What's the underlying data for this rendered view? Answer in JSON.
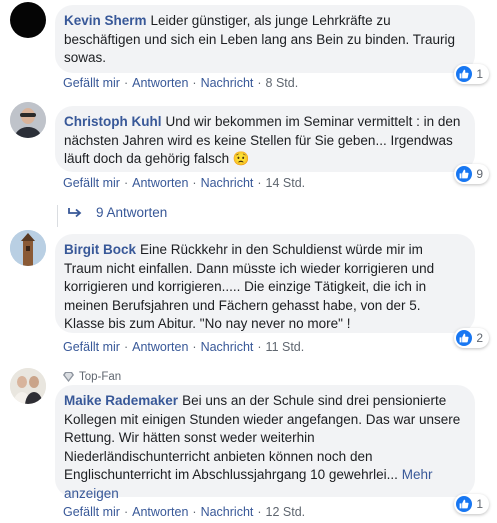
{
  "comments": [
    {
      "author": "Kevin Sherm",
      "text": "Leider günstiger, als junge Lehrkräfte zu beschäftigen und sich ein Leben lang ans Bein zu binden. Traurig sowas.",
      "like": "Gefällt mir",
      "reply": "Antworten",
      "message": "Nachricht",
      "time": "8 Std.",
      "reactions": "1"
    },
    {
      "author": "Christoph Kuhl",
      "text": "Und wir bekommen im Seminar vermittelt : in den nächsten Jahren wird es keine Stellen für Sie geben... Irgendwas läuft doch da gehörig falsch",
      "emoji": "😟",
      "like": "Gefällt mir",
      "reply": "Antworten",
      "message": "Nachricht",
      "time": "14 Std.",
      "reactions": "9",
      "replies": "9 Antworten"
    },
    {
      "author": "Birgit Bock",
      "text": "Eine Rückkehr in den Schuldienst würde mir im Traum nicht einfallen. Dann müsste ich wieder korrigieren und korrigieren und korrigieren..... Die einzige Tätigkeit, die ich in meinen Berufsjahren und Fächern gehasst habe, von der 5. Klasse bis zum Abitur. \"No nay never no more\" !",
      "like": "Gefällt mir",
      "reply": "Antworten",
      "message": "Nachricht",
      "time": "11 Std.",
      "reactions": "2"
    },
    {
      "badge": "Top-Fan",
      "author": "Maike Rademaker",
      "text": "Bei uns an der Schule sind drei pensionierte Kollegen mit einigen Stunden wieder angefangen. Das war unsere Rettung. Wir hätten sonst weder weiterhin Niederländischunterricht anbieten können noch den Englischunterricht im Abschlussjahrgang 10 gewehrlei...",
      "more": "Mehr anzeigen",
      "like": "Gefällt mir",
      "reply": "Antworten",
      "message": "Nachricht",
      "time": "12 Std.",
      "reactions": "1"
    }
  ],
  "colors": {
    "link": "#385898",
    "bubble": "#f2f3f5",
    "like_blue": "#1877f2",
    "meta": "#606770"
  }
}
